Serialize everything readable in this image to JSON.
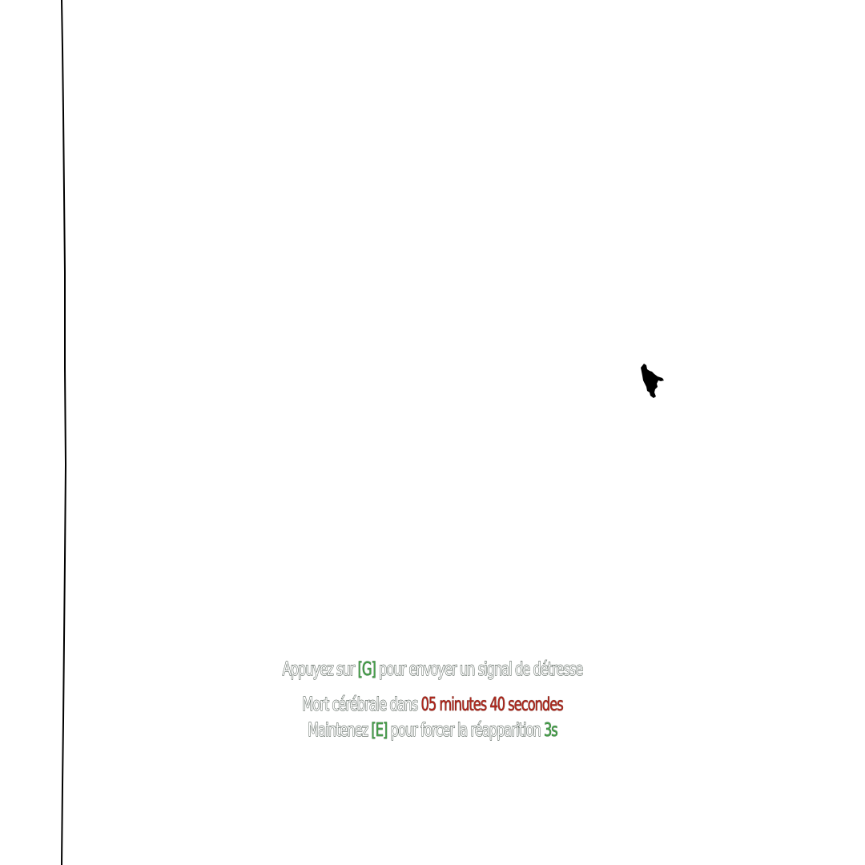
{
  "colors": {
    "background": "#ffffff",
    "text_outline": "#2f3d33",
    "key_highlight": "#46a24a",
    "timer": "#b3271d",
    "line": "#000000"
  },
  "scene": {
    "edge_line_icon": "vertical-boundary-line",
    "player_icon": "player-silhouette-icon"
  },
  "hud": {
    "distress": {
      "prefix": "Appuyez sur ",
      "key": "[G]",
      "suffix": " pour envoyer un signal de détresse"
    },
    "death": {
      "prefix": "Mort cérébrale dans ",
      "timer": "05 minutes 40 secondes"
    },
    "respawn": {
      "prefix": "Maintenez ",
      "key": "[E]",
      "middle": " pour forcer la réapparition ",
      "countdown": "3s"
    }
  }
}
